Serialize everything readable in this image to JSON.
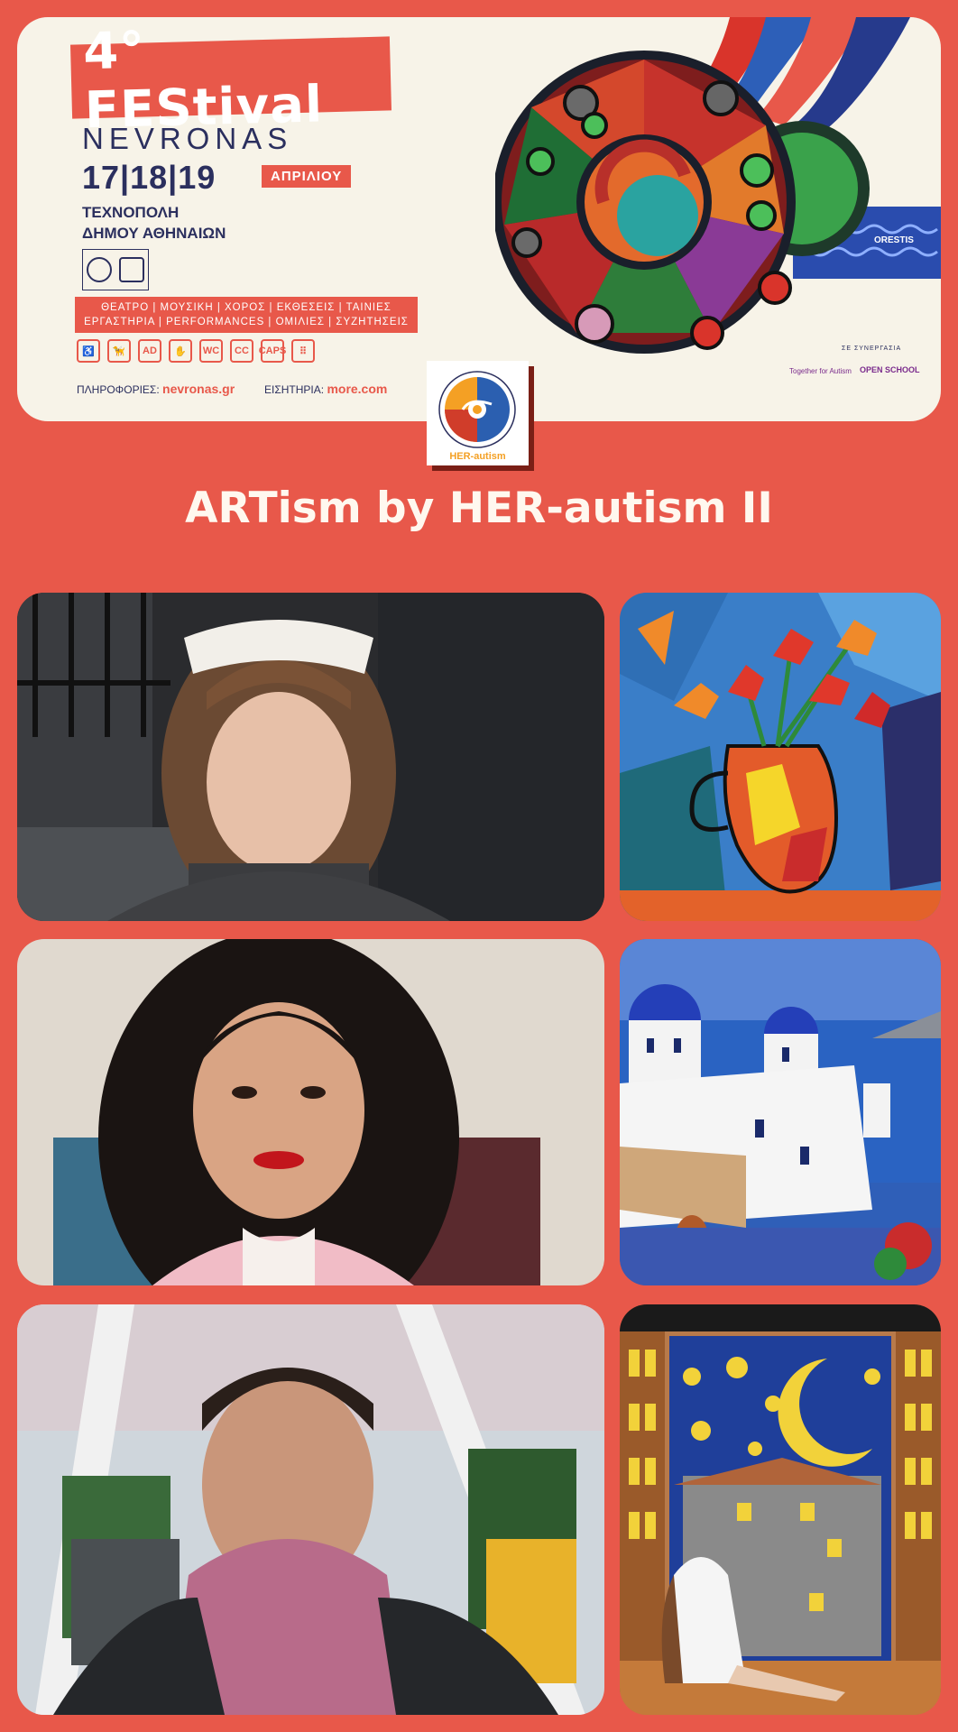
{
  "festival": {
    "number_title": "4° FEStival",
    "name": "NEVRONAS",
    "dates": "17|18|19",
    "month": "ΑΠΡΙΛΙΟΥ",
    "venue": "ΤΕΧΝΟΠΟΛΗ\nΔΗΜΟΥ ΑΘΗΝΑΙΩΝ",
    "activities": "ΘΕΑΤΡΟ | ΜΟΥΣΙΚΗ | ΧΟΡΟΣ | ΕΚΘΕΣΕΙΣ | ΤΑΙΝΙΕΣ ΕΡΓΑΣΤΗΡΙΑ | PERFORMANCES | ΟΜΙΛΙΕΣ | ΣΥΖΗΤΗΣΕΙΣ",
    "accessibility": [
      "♿",
      "🦮",
      "AD",
      "✋",
      "WC",
      "CC",
      "CAPS",
      "⠿"
    ],
    "info_label": "ΠΛΗΡΟΦΟΡΙΕΣ:",
    "info_url": "nevronas.gr",
    "tickets_label": "ΕΙΣΗΤΗΡΙΑ:",
    "tickets_url": "more.com",
    "collaboration_label": "ΣΕ ΣΥΝΕΡΓΑΣΙΑ",
    "partner_1": "Together for Autism",
    "partner_2": "OPEN SCHOOL",
    "artwork_signature": "ORESTIS"
  },
  "logo": {
    "label": "HER-autism"
  },
  "page_title": "ARTism by HER-autism II",
  "colors": {
    "background": "#e8584a",
    "banner": "#f7f3e8",
    "navy": "#2b2f5e"
  }
}
